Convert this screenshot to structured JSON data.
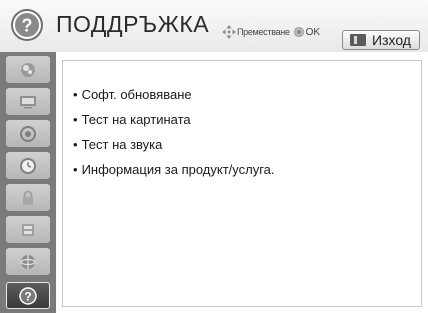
{
  "header": {
    "title": "ПОДДРЪЖКА",
    "icon": "help-icon",
    "hint_move_label": "Преместване",
    "hint_ok_label": "OK",
    "exit_label": "Изход",
    "exit_icon": "exit-key-icon"
  },
  "sidebar": {
    "items": [
      {
        "name": "picture-settings",
        "icon": "picture-icon",
        "active": false
      },
      {
        "name": "screen-settings",
        "icon": "screen-icon",
        "active": false
      },
      {
        "name": "audio-settings",
        "icon": "audio-icon",
        "active": false
      },
      {
        "name": "time-settings",
        "icon": "clock-icon",
        "active": false
      },
      {
        "name": "lock-settings",
        "icon": "lock-icon",
        "active": false
      },
      {
        "name": "options-settings",
        "icon": "options-icon",
        "active": false
      },
      {
        "name": "network-settings",
        "icon": "network-icon",
        "active": false
      },
      {
        "name": "support",
        "icon": "help-icon",
        "active": true
      }
    ]
  },
  "menu": {
    "items": [
      {
        "label": "Софт. обновяване"
      },
      {
        "label": "Тест на картината"
      },
      {
        "label": "Тест на звука"
      },
      {
        "label": "Информация за продукт/услуга."
      }
    ]
  },
  "colors": {
    "sidebar_bg": "#7a7a7a",
    "active_item_bg": "#4a4a4a",
    "header_bg": "#f2f2f2",
    "content_bg": "#ffffff"
  }
}
